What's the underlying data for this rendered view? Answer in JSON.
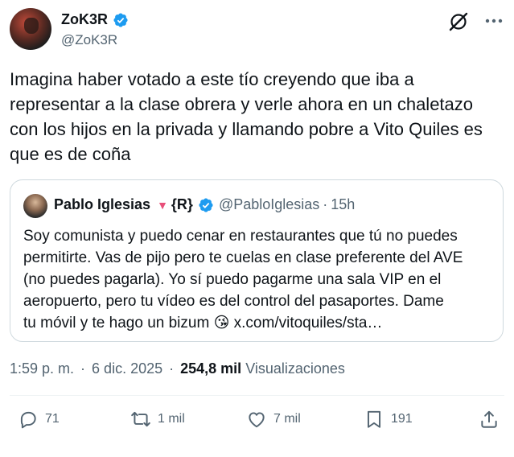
{
  "author": {
    "name": "ZoK3R",
    "handle": "@ZoK3R"
  },
  "tweet": {
    "text": "Imagina haber votado a este tío creyendo que iba a\nrepresentar a la clase obrera y verle ahora en un chaletazo\ncon los hijos en la privada y llamando pobre a Vito Quiles es\nque es de coña"
  },
  "quote": {
    "name": "Pablo Iglesias",
    "triangle": "▼",
    "suffix": "{R}",
    "handle": "@PabloIglesias",
    "dot": "·",
    "time": "15h",
    "text": "Soy comunista y puedo cenar en restaurantes que tú no puedes\npermitirte. Vas de pijo pero te cuelas en clase preferente del AVE\n(no puedes pagarla). Yo sí puedo pagarme una sala VIP en el\naeropuerto, pero tu vídeo es del control del pasaportes. Dame\ntu móvil y te hago un bizum 😘 x.com/vitoquiles/sta…"
  },
  "meta": {
    "time": "1:59 p. m.",
    "sep": "·",
    "date": "6 dic. 2025",
    "sep2": "·",
    "views": "254,8 mil",
    "views_label": "Visualizaciones"
  },
  "actions": {
    "replies": "71",
    "reposts": "1 mil",
    "likes": "7 mil",
    "bookmarks": "191"
  },
  "icons": {
    "verified": "verified-badge-icon",
    "grok": "grok-icon",
    "more": "more-icon",
    "reply": "reply-icon",
    "repost": "repost-icon",
    "like": "heart-icon",
    "bookmark": "bookmark-icon",
    "share": "share-icon"
  },
  "colors": {
    "accent": "#1d9bf0",
    "muted": "#536471",
    "text": "#0f1419",
    "triangle": "#e8507a"
  }
}
